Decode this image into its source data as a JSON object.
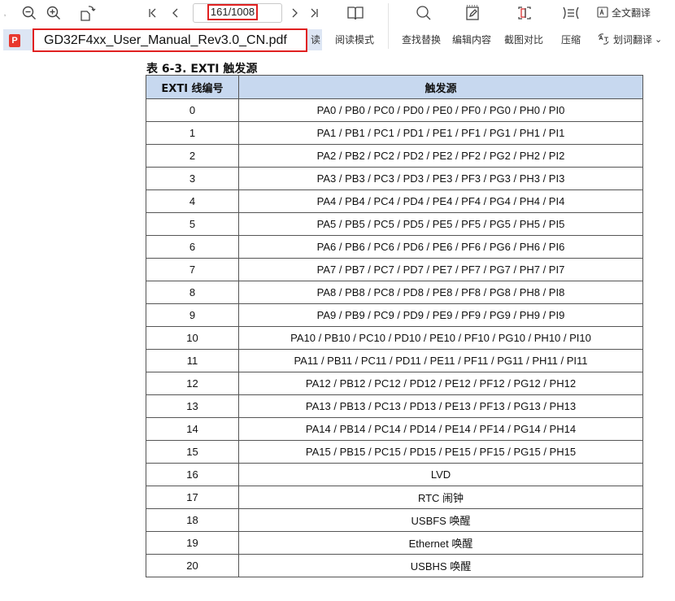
{
  "toolbar": {
    "page_indicator": "161/1008",
    "file_name": "GD32F4xx_User_Manual_Rev3.0_CN.pdf",
    "read_label_partial": "读",
    "tools": [
      {
        "label": "阅读模式",
        "icon": "book-icon"
      },
      {
        "label": "查找替换",
        "icon": "search-icon"
      },
      {
        "label": "编辑内容",
        "icon": "edit-icon"
      },
      {
        "label": "截图对比",
        "icon": "screenshot-compare-icon"
      },
      {
        "label": "压缩",
        "icon": "compress-icon"
      }
    ],
    "translate_full": "全文翻译",
    "translate_word": "划词翻译",
    "translate_word_dropdown": "⌄"
  },
  "document": {
    "table_title": "表 6-3. EXTI 触发源",
    "headers": [
      "EXTI 线编号",
      "触发源"
    ],
    "rows": [
      [
        "0",
        "PA0 / PB0 / PC0 / PD0 / PE0 / PF0 / PG0 / PH0 / PI0"
      ],
      [
        "1",
        "PA1 / PB1 / PC1 / PD1 / PE1 / PF1 / PG1 / PH1 / PI1"
      ],
      [
        "2",
        "PA2 / PB2 / PC2 / PD2 / PE2 / PF2 / PG2 / PH2 / PI2"
      ],
      [
        "3",
        "PA3 / PB3 / PC3 / PD3 / PE3 / PF3 / PG3 / PH3 / PI3"
      ],
      [
        "4",
        "PA4 / PB4 / PC4 / PD4 / PE4 / PF4 / PG4 / PH4 / PI4"
      ],
      [
        "5",
        "PA5 / PB5 / PC5 / PD5 / PE5 / PF5 / PG5 / PH5 / PI5"
      ],
      [
        "6",
        "PA6 / PB6 / PC6 / PD6 / PE6 / PF6 / PG6 / PH6 / PI6"
      ],
      [
        "7",
        "PA7 / PB7 / PC7 / PD7 / PE7 / PF7 / PG7 / PH7 / PI7"
      ],
      [
        "8",
        "PA8 / PB8 / PC8 / PD8 / PE8 / PF8 / PG8 / PH8 / PI8"
      ],
      [
        "9",
        "PA9 / PB9 / PC9 / PD9 / PE9 / PF9 / PG9 / PH9 / PI9"
      ],
      [
        "10",
        "PA10 / PB10 / PC10 / PD10 / PE10 / PF10 / PG10 / PH10 / PI10"
      ],
      [
        "11",
        "PA11 / PB11 / PC11 / PD11 / PE11 / PF11 / PG11 / PH11 / PI11"
      ],
      [
        "12",
        "PA12 / PB12 / PC12 / PD12 / PE12 / PF12 / PG12 / PH12"
      ],
      [
        "13",
        "PA13 / PB13 / PC13 / PD13 / PE13 / PF13 / PG13 / PH13"
      ],
      [
        "14",
        "PA14 / PB14 / PC14 / PD14 / PE14 / PF14 / PG14 / PH14"
      ],
      [
        "15",
        "PA15 / PB15 / PC15 / PD15 / PE15 / PF15 / PG15 / PH15"
      ],
      [
        "16",
        "LVD"
      ],
      [
        "17",
        "RTC 闹钟"
      ],
      [
        "18",
        "USBFS 唤醒"
      ],
      [
        "19",
        "Ethernet 唤醒"
      ],
      [
        "20",
        "USBHS 唤醒"
      ]
    ]
  },
  "colors": {
    "accent_red": "#e02020",
    "header_bg": "#c7d8ef",
    "selection_bg": "#dde6f4"
  }
}
